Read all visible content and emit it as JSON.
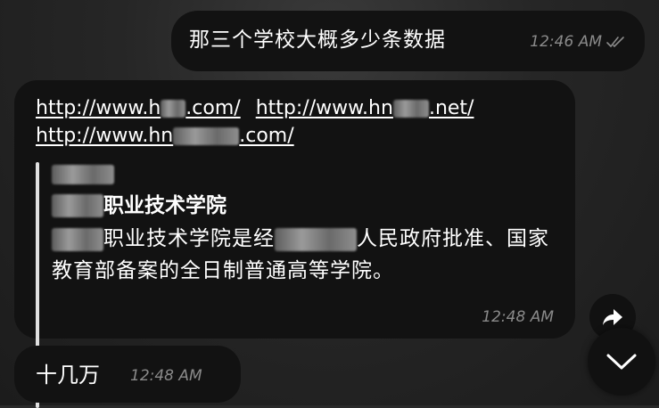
{
  "messages": {
    "outgoing": {
      "text": "那三个学校大概多少条数据",
      "time": "12:46 AM",
      "status_icon": "double-check-icon"
    },
    "incoming_links": {
      "link1_prefix": "http://www.h",
      "link1_suffix": ".com/",
      "link2_prefix": "http://www.hn",
      "link2_suffix": ".net/",
      "link3_prefix": "http://www.hn",
      "link3_suffix": ".com/",
      "preview_title_suffix": "职业技术学院",
      "preview_desc_part1": "职业技术学院是经",
      "preview_desc_part2": "人民政府批准、国家教育部备案的全日制普通高等学院。",
      "time": "12:48 AM"
    },
    "incoming_short": {
      "text": "十几万",
      "time": "12:48 AM"
    }
  },
  "buttons": {
    "share_icon": "share-arrow-icon",
    "scroll_down_icon": "chevron-down-icon"
  },
  "colors": {
    "bubble": "#121212",
    "text": "#ffffff",
    "meta": "#8a8a8a",
    "quote_bar": "#e0e0e0"
  }
}
